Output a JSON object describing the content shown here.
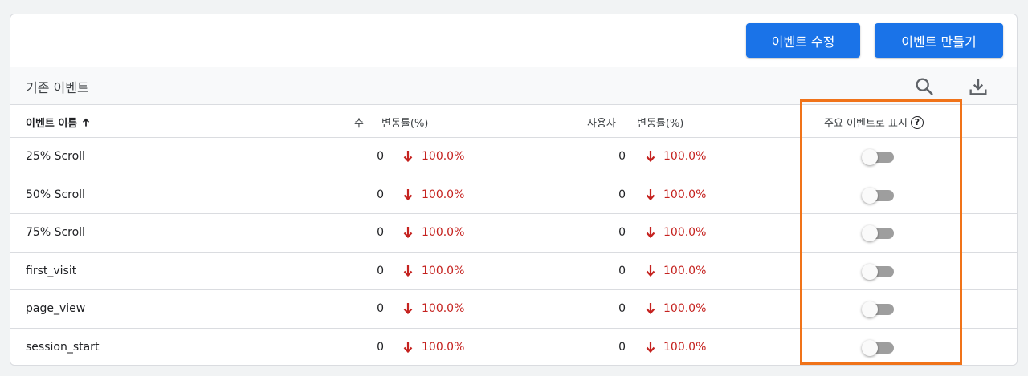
{
  "toolbar": {
    "edit_label": "이벤트 수정",
    "create_label": "이벤트 만들기"
  },
  "section": {
    "title": "기존 이벤트",
    "search_icon": "search-icon",
    "download_icon": "download-icon"
  },
  "columns": {
    "name": "이벤트 이름",
    "name_sort_icon": "arrow-up-icon",
    "count": "수",
    "count_change": "변동률(%)",
    "users": "사용자",
    "users_change": "변동률(%)",
    "key_event": "주요 이벤트로 표시",
    "help_icon": "?"
  },
  "rows": [
    {
      "name": "25% Scroll",
      "count": "0",
      "count_change": "100.0%",
      "users": "0",
      "users_change": "100.0%",
      "key_event": false
    },
    {
      "name": "50% Scroll",
      "count": "0",
      "count_change": "100.0%",
      "users": "0",
      "users_change": "100.0%",
      "key_event": false
    },
    {
      "name": "75% Scroll",
      "count": "0",
      "count_change": "100.0%",
      "users": "0",
      "users_change": "100.0%",
      "key_event": false
    },
    {
      "name": "first_visit",
      "count": "0",
      "count_change": "100.0%",
      "users": "0",
      "users_change": "100.0%",
      "key_event": false
    },
    {
      "name": "page_view",
      "count": "0",
      "count_change": "100.0%",
      "users": "0",
      "users_change": "100.0%",
      "key_event": false
    },
    {
      "name": "session_start",
      "count": "0",
      "count_change": "100.0%",
      "users": "0",
      "users_change": "100.0%",
      "key_event": false
    }
  ],
  "colors": {
    "primary": "#1a73e8",
    "negative": "#c5221f",
    "highlight": "#f07319"
  }
}
